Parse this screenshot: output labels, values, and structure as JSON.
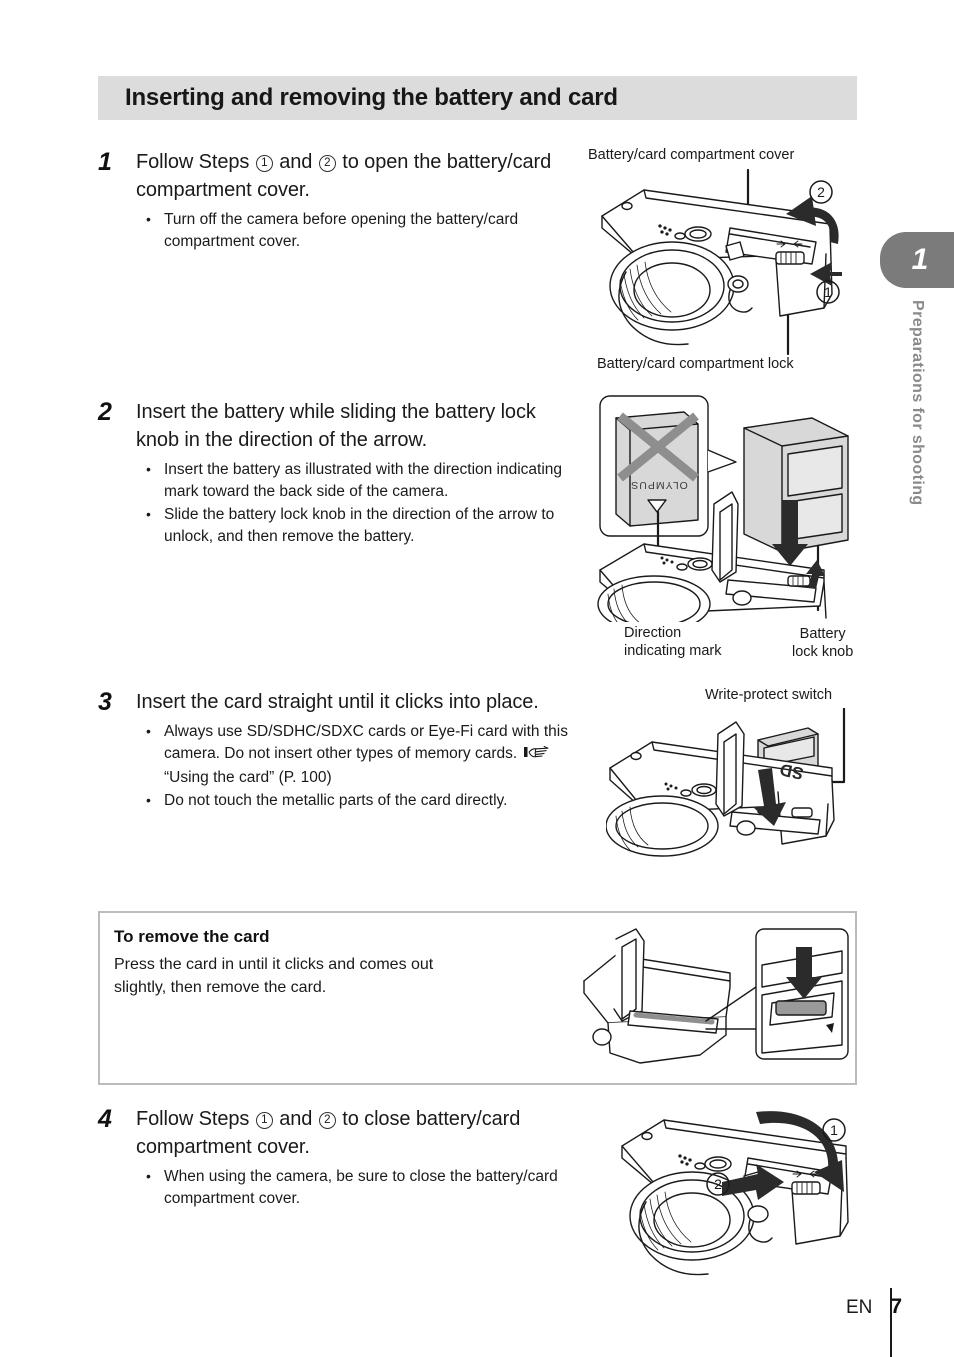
{
  "header": {
    "title": "Inserting and removing the battery and card"
  },
  "chapter": {
    "number": "1",
    "label": "Preparations for shooting"
  },
  "steps": [
    {
      "number": "1",
      "heading_before": "Follow Steps",
      "circle_a": "1",
      "heading_mid": "and",
      "circle_b": "2",
      "heading_after": "to open the battery/card compartment cover.",
      "bullets": [
        "Turn off the camera before opening the battery/card compartment cover."
      ]
    },
    {
      "number": "2",
      "heading": "Insert the battery while sliding the battery lock knob in the direction of the arrow.",
      "bullets": [
        "Insert the battery as illustrated with the direction indicating mark toward the back side of the camera.",
        "Slide the battery lock knob in the direction of the arrow to unlock, and then remove the battery."
      ]
    },
    {
      "number": "3",
      "heading": "Insert the card straight until it clicks into place.",
      "bullets": [
        "Always use SD/SDHC/SDXC cards or Eye-Fi card with this camera. Do not insert other types of memory cards.",
        "Do not touch the metallic parts of the card directly."
      ],
      "reference": "“Using the card” (P. 100)"
    },
    {
      "number": "4",
      "heading_before": "Follow Steps",
      "circle_a": "1",
      "heading_mid": "and",
      "circle_b": "2",
      "heading_after": "to close battery/card compartment cover.",
      "bullets": [
        "When using the camera, be sure to close the battery/card compartment cover."
      ]
    }
  ],
  "figures": {
    "fig1": {
      "label_top": "Battery/card compartment cover",
      "label_bottom": "Battery/card compartment lock",
      "marker_1": "1",
      "marker_2": "2"
    },
    "fig2": {
      "label_left": "Direction\nindicating mark",
      "label_right": "Battery\nlock knob",
      "battery_brand": "OLYMPUS"
    },
    "fig3": {
      "label_top": "Write-protect switch",
      "card_text": "SD"
    },
    "fig4": {
      "marker_1": "1",
      "marker_2": "2"
    }
  },
  "note_box": {
    "title": "To remove the card",
    "text": "Press the card in until it clicks and comes out\nslightly, then remove the card."
  },
  "footer": {
    "language": "EN",
    "page_number": "7"
  },
  "colors": {
    "title_bar_bg": "#dcdcdc",
    "tab_gray": "#7b7b7b",
    "label_gray": "#8a8a8a",
    "box_border": "#bcbcbc",
    "ink": "#1a1a1a"
  }
}
